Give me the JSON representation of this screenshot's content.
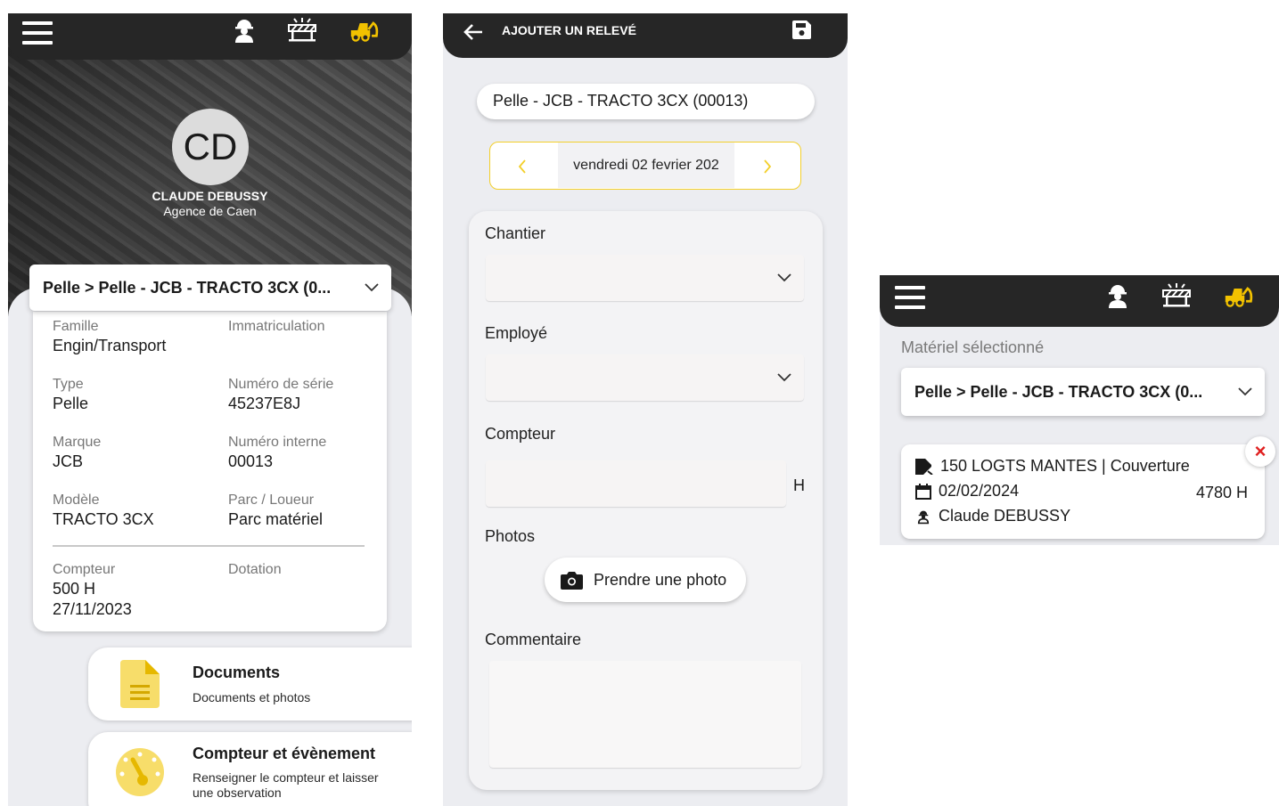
{
  "screen1": {
    "user": {
      "initials": "CD",
      "name": "CLAUDE DEBUSSY",
      "agency": "Agence de Caen"
    },
    "selected_equipment": "Pelle > Pelle - JCB - TRACTO 3CX (0...",
    "fields": {
      "famille_label": "Famille",
      "famille_value": "Engin/Transport",
      "immat_label": "Immatriculation",
      "immat_value": "",
      "type_label": "Type",
      "type_value": "Pelle",
      "serie_label": "Numéro de série",
      "serie_value": "45237E8J",
      "marque_label": "Marque",
      "marque_value": "JCB",
      "interne_label": "Numéro interne",
      "interne_value": "00013",
      "modele_label": "Modèle",
      "modele_value": "TRACTO 3CX",
      "parc_label": "Parc / Loueur",
      "parc_value": "Parc matériel",
      "compteur_label": "Compteur",
      "compteur_value": "500 H",
      "compteur_date": "27/11/2023",
      "dotation_label": "Dotation",
      "dotation_value": ""
    },
    "menu": [
      {
        "title": "Documents",
        "subtitle": "Documents et photos"
      },
      {
        "title": "Compteur et évènement",
        "subtitle_line1": "Renseigner le compteur et laisser",
        "subtitle_line2": "une observation"
      }
    ]
  },
  "screen2": {
    "header_title": "AJOUTER UN RELEVÉ",
    "equipment": "Pelle - JCB - TRACTO 3CX (00013)",
    "date": "vendredi 02 fevrier 202",
    "labels": {
      "chantier": "Chantier",
      "employe": "Employé",
      "compteur": "Compteur",
      "unit": "H",
      "photos": "Photos",
      "photo_button": "Prendre une photo",
      "commentaire": "Commentaire"
    }
  },
  "screen3": {
    "selected_label": "Matériel sélectionné",
    "selected_equipment": "Pelle > Pelle - JCB - TRACTO 3CX (0...",
    "entry": {
      "site": "150 LOGTS MANTES | Couverture",
      "date": "02/02/2024",
      "counter": "4780 H",
      "employee": "Claude DEBUSSY"
    },
    "close_glyph": "×"
  },
  "colors": {
    "topbar": "#262626",
    "accent": "#f3cf2a",
    "equipment_icon": "#f2c200",
    "close": "#e02020"
  }
}
